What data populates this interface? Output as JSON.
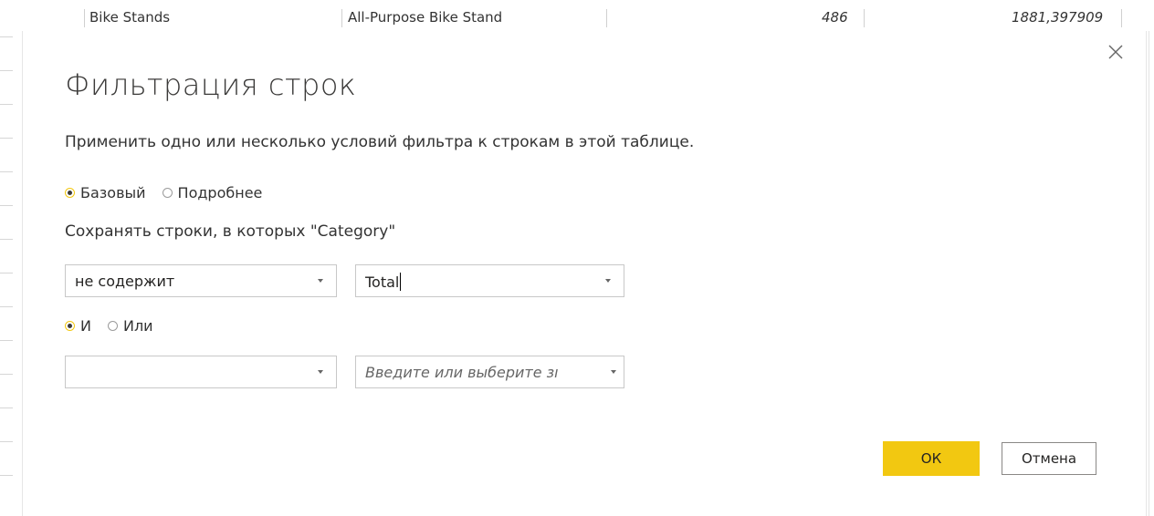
{
  "background_table": {
    "row": {
      "category": "Bike Stands",
      "product": "All-Purpose Bike Stand",
      "quantity": "486",
      "amount": "1881,397909"
    }
  },
  "dialog": {
    "title": "Фильтрация строк",
    "description": "Применить одно или несколько условий фильтра к строкам в этой таблице.",
    "mode_options": [
      {
        "label": "Базовый",
        "checked": true
      },
      {
        "label": "Подробнее",
        "checked": false
      }
    ],
    "keep_rows_label": "Сохранять строки, в которых \"Category\"",
    "condition1": {
      "operator": "не содержит",
      "value": "Total"
    },
    "logic_options": [
      {
        "label": "И",
        "checked": true
      },
      {
        "label": "Или",
        "checked": false
      }
    ],
    "condition2": {
      "operator": "",
      "value_placeholder": "Введите или выберите зı"
    },
    "ok_label": "ОК",
    "cancel_label": "Отмена",
    "icons": {
      "close": "close-icon",
      "dropdown": "chevron-down-icon"
    },
    "colors": {
      "accent": "#f2c811",
      "title_text": "#3b3a39"
    }
  }
}
